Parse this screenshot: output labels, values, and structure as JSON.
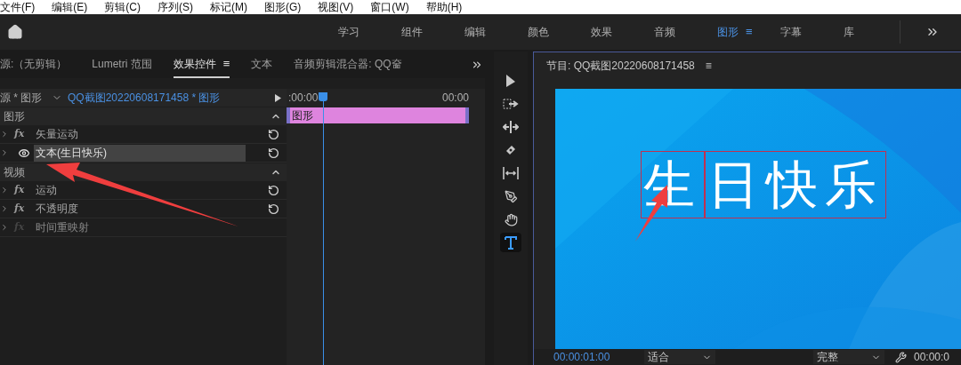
{
  "menu": [
    "文件(F)",
    "编辑(E)",
    "剪辑(C)",
    "序列(S)",
    "标记(M)",
    "图形(G)",
    "视图(V)",
    "窗口(W)",
    "帮助(H)"
  ],
  "workspaces": [
    {
      "label": "学习",
      "selected": false
    },
    {
      "label": "组件",
      "selected": false
    },
    {
      "label": "编辑",
      "selected": false
    },
    {
      "label": "颜色",
      "selected": false
    },
    {
      "label": "效果",
      "selected": false
    },
    {
      "label": "音频",
      "selected": false
    },
    {
      "label": "图形",
      "selected": true,
      "menu_icon": "≡"
    },
    {
      "label": "字幕",
      "selected": false
    },
    {
      "label": "库",
      "selected": false
    }
  ],
  "panel_tabs": [
    {
      "label": "源:（无剪辑）",
      "selected": false
    },
    {
      "label": "Lumetri 范围",
      "selected": false
    },
    {
      "label": "效果控件",
      "selected": true,
      "menu_icon": "≡"
    },
    {
      "label": "文本",
      "selected": false
    },
    {
      "label": "音频剪辑混合器: QQ奤",
      "selected": false
    }
  ],
  "effect_controls": {
    "source": "源 * 图形",
    "clip": "QQ截图20220608171458 * 图形",
    "time_start": ":00:00",
    "time_end": "00:00",
    "clip_label": "图形",
    "rows": [
      {
        "kind": "section",
        "label": "图形"
      },
      {
        "kind": "fx",
        "label": "矢量运动",
        "selected": false,
        "disabled": false
      },
      {
        "kind": "eye",
        "label": "文本(生日快乐)",
        "selected": true,
        "disabled": false
      },
      {
        "kind": "section",
        "label": "视频"
      },
      {
        "kind": "fx",
        "label": "运动",
        "selected": false,
        "disabled": false
      },
      {
        "kind": "fx",
        "label": "不透明度",
        "selected": false,
        "disabled": false
      },
      {
        "kind": "fx",
        "label": "时间重映射",
        "selected": false,
        "disabled": true
      }
    ]
  },
  "tools": [
    {
      "kind": "select",
      "selected": false
    },
    {
      "kind": "track",
      "selected": false
    },
    {
      "kind": "ripple",
      "selected": false
    },
    {
      "kind": "razor",
      "selected": false
    },
    {
      "kind": "slip",
      "selected": false
    },
    {
      "kind": "pen",
      "selected": false
    },
    {
      "kind": "hand",
      "selected": false
    },
    {
      "kind": "type",
      "selected": true
    }
  ],
  "program": {
    "title": "节目: QQ截图20220608171458",
    "menu_icon": "≡",
    "text_boxes": [
      "生",
      "日快乐"
    ],
    "timecode": "00:00:01:00",
    "zoom": "适合",
    "quality": "完整",
    "timecode_right": "00:00:0"
  }
}
